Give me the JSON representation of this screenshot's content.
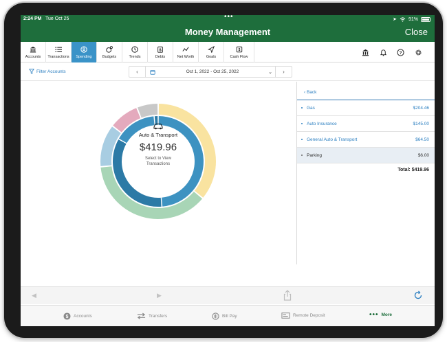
{
  "status": {
    "time": "2:24 PM",
    "date": "Tue Oct 25",
    "battery": "91%"
  },
  "header": {
    "title": "Money Management",
    "close_label": "Close"
  },
  "toolbar": {
    "tabs": [
      {
        "label": "Accounts",
        "icon": "bank-icon"
      },
      {
        "label": "Transactions",
        "icon": "list-icon"
      },
      {
        "label": "Spending",
        "icon": "spending-icon",
        "active": true
      },
      {
        "label": "Budgets",
        "icon": "budgets-icon"
      },
      {
        "label": "Trends",
        "icon": "clock-icon"
      },
      {
        "label": "Debts",
        "icon": "debts-icon"
      },
      {
        "label": "Net Worth",
        "icon": "line-chart-icon"
      },
      {
        "label": "Goals",
        "icon": "goal-arrow-icon"
      },
      {
        "label": "Cash Flow",
        "icon": "cash-flow-icon"
      }
    ],
    "right_icons": [
      "bank-icon",
      "bell-icon",
      "help-icon",
      "gear-icon"
    ]
  },
  "filter": {
    "label": "Filter Accounts"
  },
  "date_range": {
    "label": "Oct 1, 2022 - Oct 25, 2022"
  },
  "chart": {
    "center_title": "Auto & Transport",
    "center_amount": "$419.96",
    "center_sub_line1": "Select to View",
    "center_sub_line2": "Transactions",
    "center_icon": "car-icon",
    "colors": {
      "outer": [
        "#f9e3a0",
        "#a8d5b6",
        "#a8cde2",
        "#e4aabd",
        "#c8c8c8"
      ],
      "inner": [
        "#3d92c1",
        "#2c7aa6"
      ]
    }
  },
  "chart_data": {
    "type": "pie",
    "rings": [
      {
        "ring": "outer",
        "slices": [
          0.36,
          0.375,
          0.12,
          0.085,
          0.06
        ]
      },
      {
        "ring": "inner",
        "categories": [
          "Gas",
          "Auto Insurance",
          "General Auto & Transport",
          "Parking"
        ],
        "values": [
          204.46,
          145.0,
          64.5,
          6.0
        ]
      }
    ]
  },
  "panel": {
    "back_label": "Back",
    "items": [
      {
        "name": "Gas",
        "amount": "$204.46"
      },
      {
        "name": "Auto Insurance",
        "amount": "$145.00"
      },
      {
        "name": "General Auto & Transport",
        "amount": "$64.50"
      },
      {
        "name": "Parking",
        "amount": "$6.00"
      }
    ],
    "total": "Total: $419.96"
  },
  "tabbar": {
    "accounts": "Accounts",
    "transfers": "Transfers",
    "bill_pay": "Bill Pay",
    "remote_deposit": "Remote Deposit",
    "more": "More"
  }
}
